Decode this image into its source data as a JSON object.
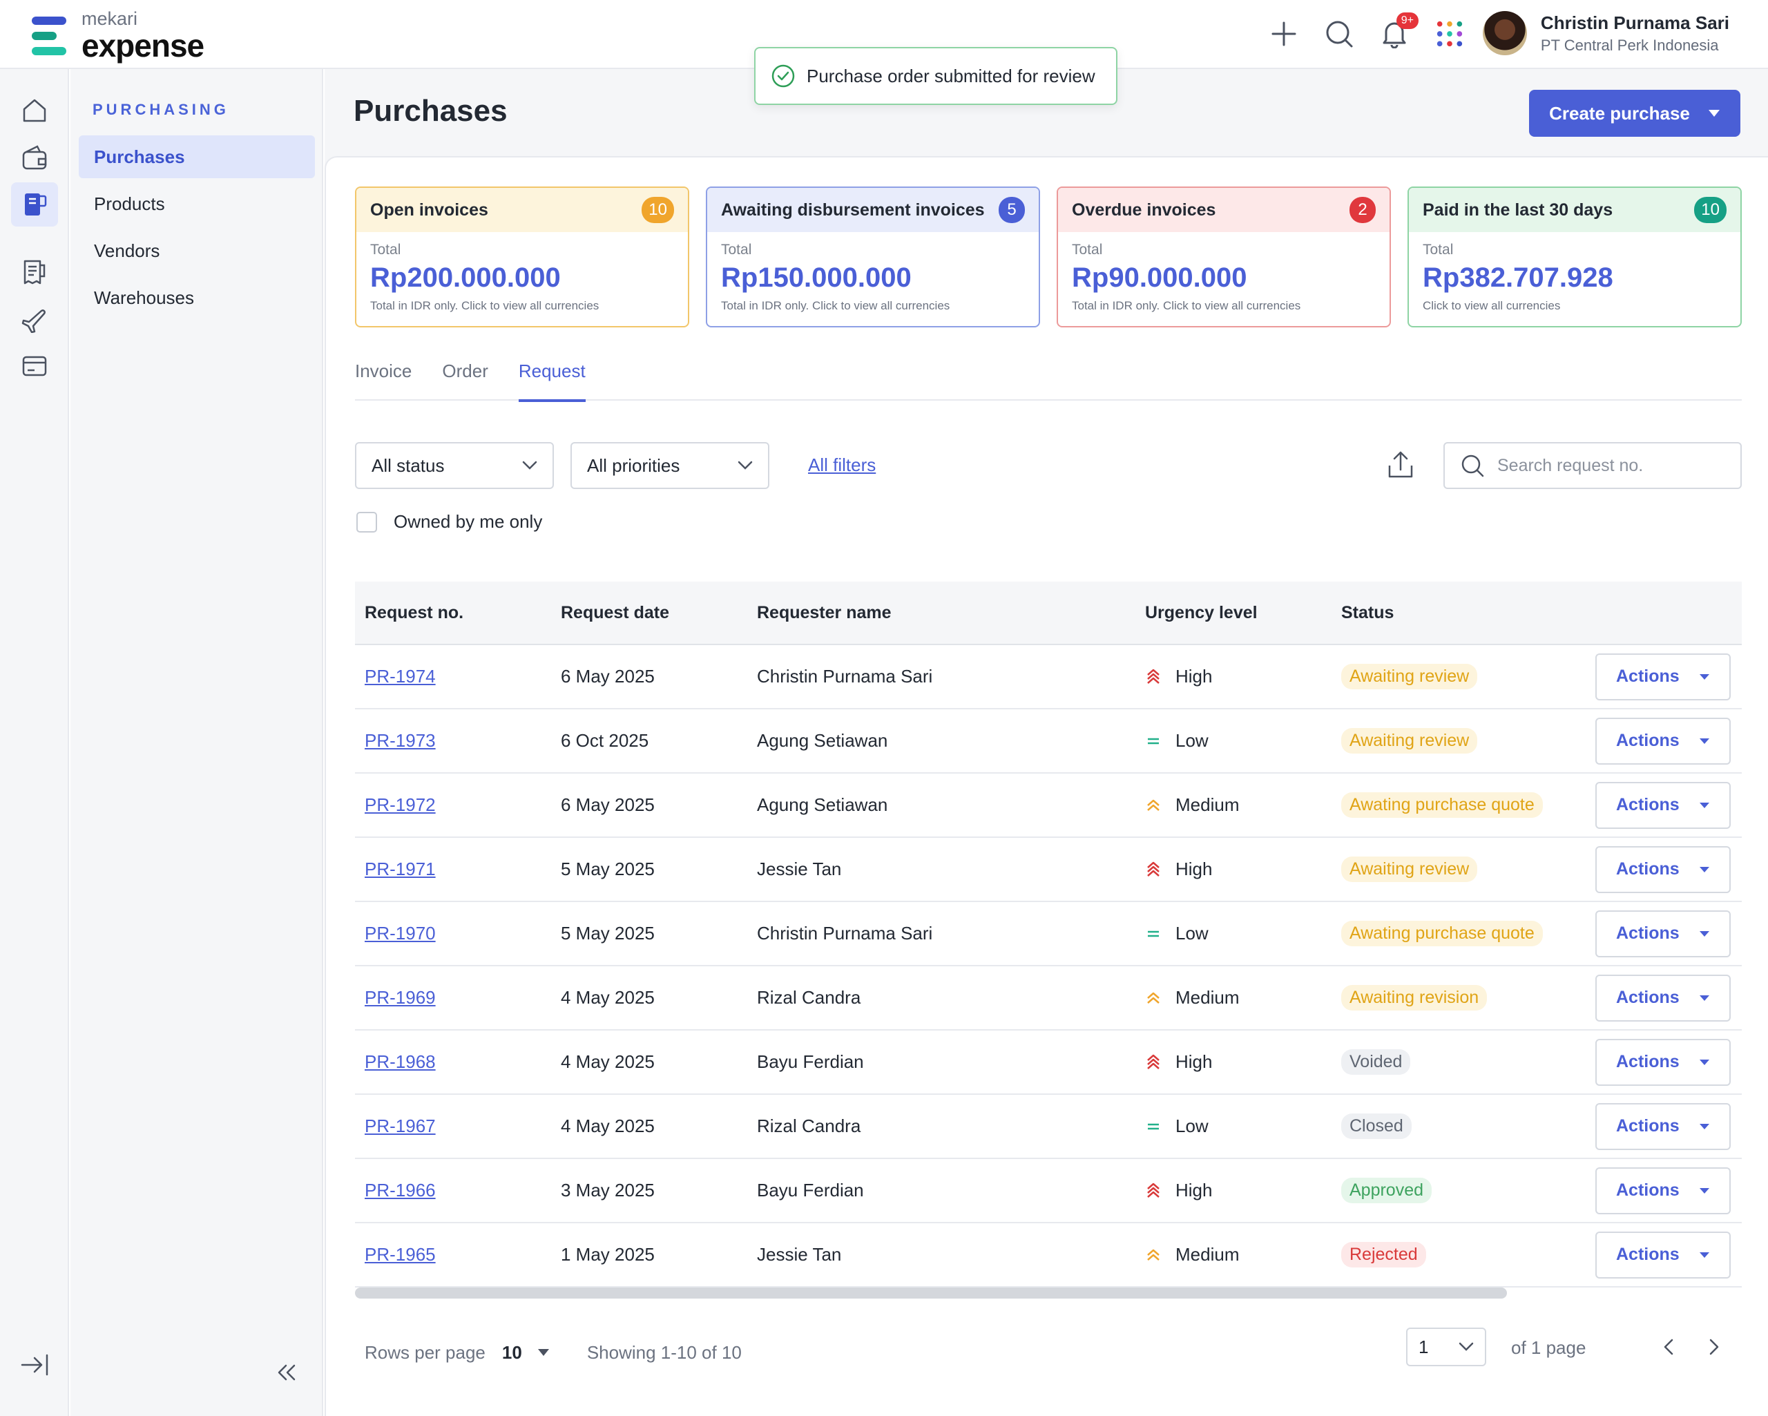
{
  "app": {
    "brand_small": "mekari",
    "brand_big": "expense"
  },
  "header": {
    "notification_count": "9+",
    "user_name": "Christin Purnama Sari",
    "user_company": "PT Central Perk Indonesia"
  },
  "toast": {
    "message": "Purchase order submitted for review"
  },
  "sidebar": {
    "section_title": "PURCHASING",
    "items": [
      {
        "label": "Purchases",
        "active": true
      },
      {
        "label": "Products"
      },
      {
        "label": "Vendors"
      },
      {
        "label": "Warehouses"
      }
    ]
  },
  "page": {
    "title": "Purchases",
    "create_label": "Create purchase"
  },
  "cards": [
    {
      "title": "Open invoices",
      "count": "10",
      "label": "Total",
      "amount": "Rp200.000.000",
      "note": "Total in IDR only. Click to view all currencies",
      "border": "#f2c66a",
      "head_bg": "#fdf4dc",
      "badge": "#f0a52c"
    },
    {
      "title": "Awaiting disbursement invoices",
      "count": "5",
      "label": "Total",
      "amount": "Rp150.000.000",
      "note": "Total in IDR only. Click to view all currencies",
      "border": "#8ea0e6",
      "head_bg": "#e8ecfb",
      "badge": "#4a5fd6"
    },
    {
      "title": "Overdue invoices",
      "count": "2",
      "label": "Total",
      "amount": "Rp90.000.000",
      "note": "Total in IDR only. Click to view all currencies",
      "border": "#ec9a9a",
      "head_bg": "#fde8e8",
      "badge": "#e0383d"
    },
    {
      "title": "Paid in the last 30 days",
      "count": "10",
      "label": "Total",
      "amount": "Rp382.707.928",
      "note": "Click to view all currencies",
      "border": "#8ed4a4",
      "head_bg": "#e5f6ea",
      "badge": "#16a085"
    }
  ],
  "tabs": [
    {
      "label": "Invoice"
    },
    {
      "label": "Order"
    },
    {
      "label": "Request",
      "active": true
    }
  ],
  "filters": {
    "status": "All status",
    "priority": "All priorities",
    "all_filters": "All filters",
    "search_placeholder": "Search request no.",
    "owned_label": "Owned by me only"
  },
  "table": {
    "headers": [
      "Request no.",
      "Request date",
      "Requester name",
      "Urgency level",
      "Status",
      ""
    ],
    "action_label": "Actions",
    "rows": [
      {
        "no": "PR-1974",
        "date": "6 May 2025",
        "name": "Christin Purnama Sari",
        "urgency": "High",
        "status": "Awaiting review",
        "tone": "yellow"
      },
      {
        "no": "PR-1973",
        "date": "6 Oct 2025",
        "name": "Agung Setiawan",
        "urgency": "Low",
        "status": "Awaiting review",
        "tone": "yellow"
      },
      {
        "no": "PR-1972",
        "date": "6 May 2025",
        "name": "Agung Setiawan",
        "urgency": "Medium",
        "status": "Awating purchase quote",
        "tone": "yellow"
      },
      {
        "no": "PR-1971",
        "date": "5 May 2025",
        "name": "Jessie Tan",
        "urgency": "High",
        "status": "Awaiting review",
        "tone": "yellow"
      },
      {
        "no": "PR-1970",
        "date": "5 May 2025",
        "name": "Christin Purnama Sari",
        "urgency": "Low",
        "status": "Awating purchase quote",
        "tone": "yellow"
      },
      {
        "no": "PR-1969",
        "date": "4 May 2025",
        "name": "Rizal Candra",
        "urgency": "Medium",
        "status": "Awaiting revision",
        "tone": "yellow"
      },
      {
        "no": "PR-1968",
        "date": "4 May 2025",
        "name": "Bayu Ferdian",
        "urgency": "High",
        "status": "Voided",
        "tone": "gray"
      },
      {
        "no": "PR-1967",
        "date": "4 May 2025",
        "name": "Rizal Candra",
        "urgency": "Low",
        "status": "Closed",
        "tone": "gray"
      },
      {
        "no": "PR-1966",
        "date": "3 May 2025",
        "name": "Bayu Ferdian",
        "urgency": "High",
        "status": "Approved",
        "tone": "green"
      },
      {
        "no": "PR-1965",
        "date": "1 May 2025",
        "name": "Jessie Tan",
        "urgency": "Medium",
        "status": "Rejected",
        "tone": "red"
      }
    ]
  },
  "pagination": {
    "rows_label": "Rows per page",
    "rows_value": "10",
    "showing": "Showing 1-10 of 10",
    "page": "1",
    "of_label": "of 1 page"
  }
}
